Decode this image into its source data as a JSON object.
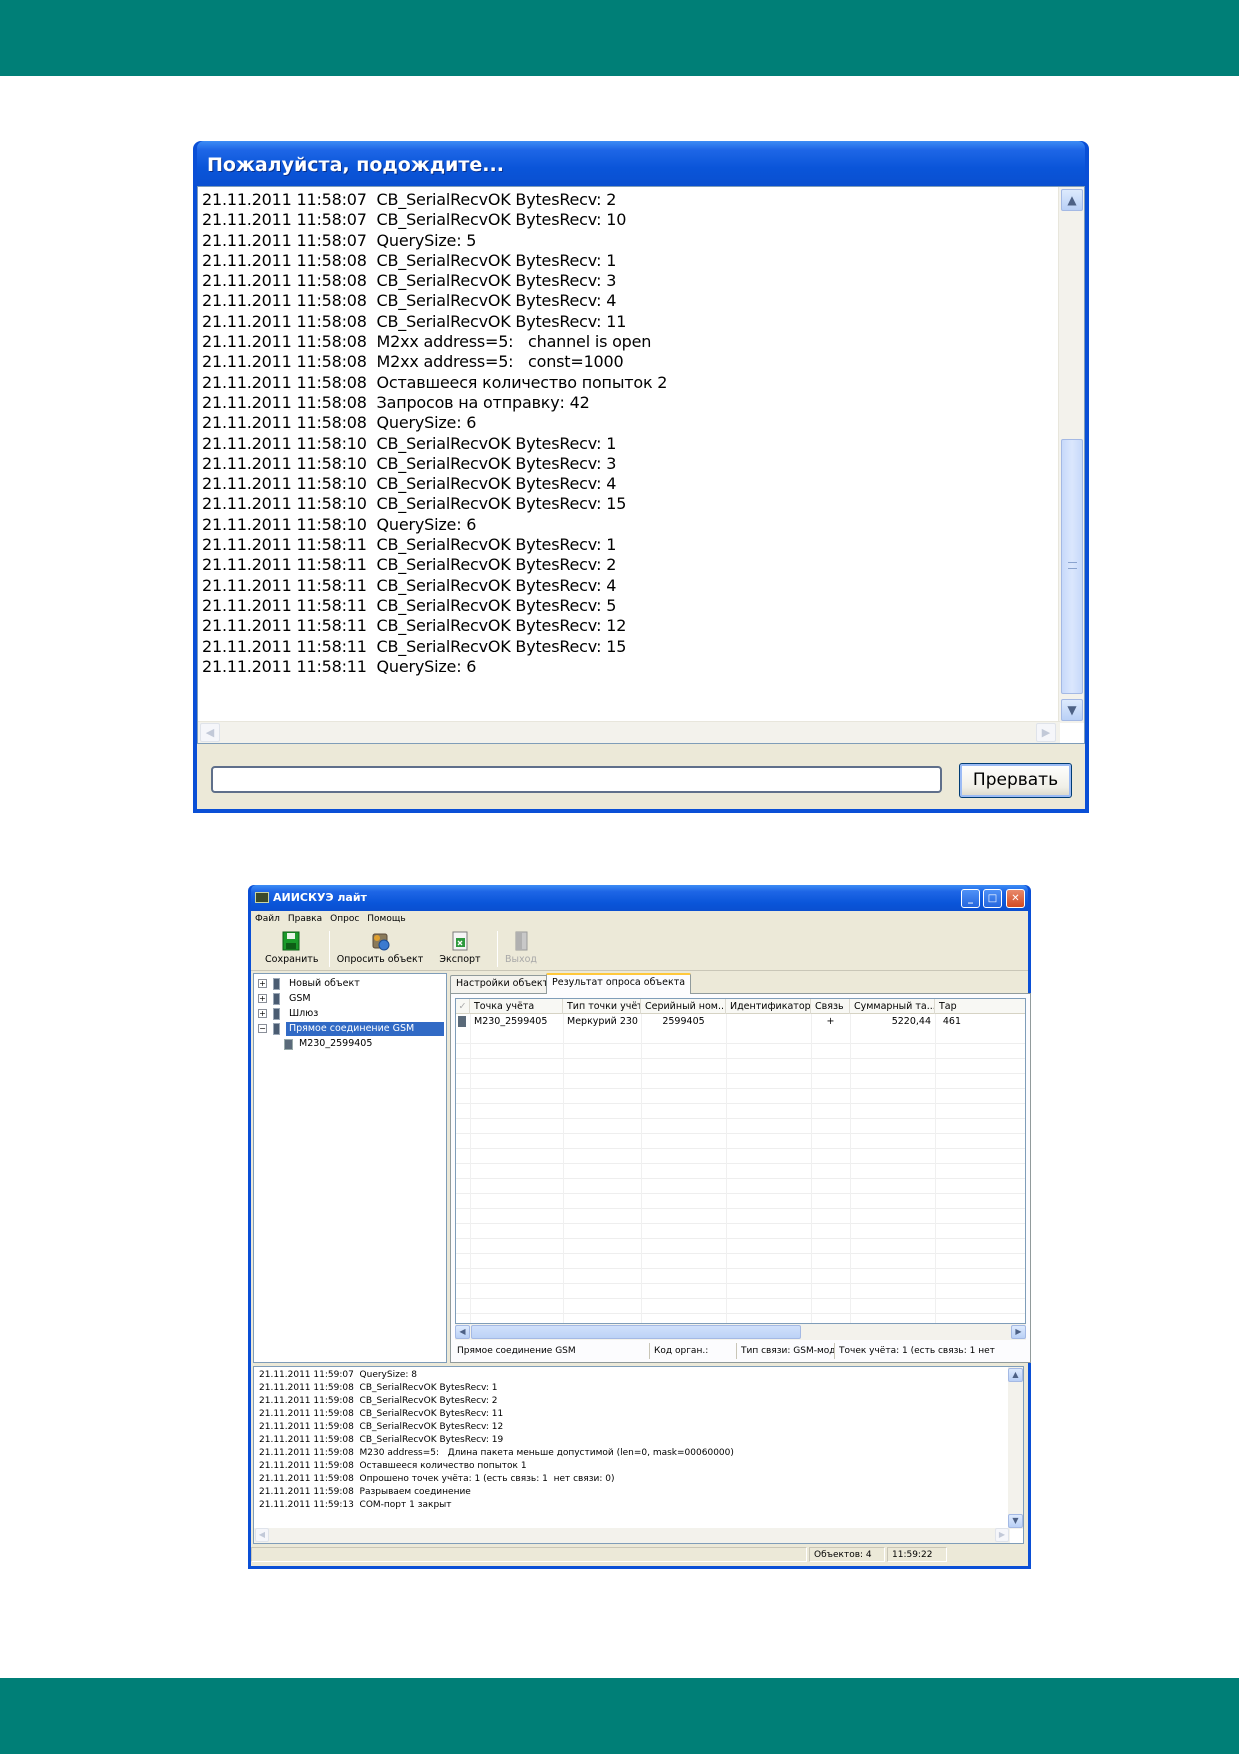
{
  "wait_dialog": {
    "title": "Пожалуйста, подождите...",
    "log": [
      "21.11.2011 11:58:07  CB_SerialRecvOK BytesRecv: 2",
      "21.11.2011 11:58:07  CB_SerialRecvOK BytesRecv: 10",
      "21.11.2011 11:58:07  QuerySize: 5",
      "21.11.2011 11:58:08  CB_SerialRecvOK BytesRecv: 1",
      "21.11.2011 11:58:08  CB_SerialRecvOK BytesRecv: 3",
      "21.11.2011 11:58:08  CB_SerialRecvOK BytesRecv: 4",
      "21.11.2011 11:58:08  CB_SerialRecvOK BytesRecv: 11",
      "21.11.2011 11:58:08  M2xx address=5:   channel is open",
      "21.11.2011 11:58:08  M2xx address=5:   const=1000",
      "21.11.2011 11:58:08  Оставшееся количество попыток 2",
      "21.11.2011 11:58:08  Запросов на отправку: 42",
      "21.11.2011 11:58:08  QuerySize: 6",
      "21.11.2011 11:58:10  CB_SerialRecvOK BytesRecv: 1",
      "21.11.2011 11:58:10  CB_SerialRecvOK BytesRecv: 3",
      "21.11.2011 11:58:10  CB_SerialRecvOK BytesRecv: 4",
      "21.11.2011 11:58:10  CB_SerialRecvOK BytesRecv: 15",
      "21.11.2011 11:58:10  QuerySize: 6",
      "21.11.2011 11:58:11  CB_SerialRecvOK BytesRecv: 1",
      "21.11.2011 11:58:11  CB_SerialRecvOK BytesRecv: 2",
      "21.11.2011 11:58:11  CB_SerialRecvOK BytesRecv: 4",
      "21.11.2011 11:58:11  CB_SerialRecvOK BytesRecv: 5",
      "21.11.2011 11:58:11  CB_SerialRecvOK BytesRecv: 12",
      "21.11.2011 11:58:11  CB_SerialRecvOK BytesRecv: 15",
      "21.11.2011 11:58:11  QuerySize: 6"
    ],
    "abort_label": "Прервать"
  },
  "app": {
    "title": "АИИСКУЭ лайт",
    "menu": [
      "Файл",
      "Правка",
      "Опрос",
      "Помощь"
    ],
    "toolbar": {
      "save": "Сохранить",
      "poll": "Опросить объект",
      "export": "Экспорт",
      "exit": "Выход"
    },
    "tree": {
      "items": [
        "Новый объект",
        "GSM",
        "Шлюз",
        "Прямое соединение GSM"
      ],
      "child": "M230_2599405"
    },
    "tabs": [
      "Настройки объекта",
      "Результат опроса объекта"
    ],
    "grid": {
      "headers": [
        "Точка учёта",
        "Тип точки учёта",
        "Серийный ном...",
        "Идентификатор",
        "Связь",
        "Суммарный та...",
        "Тар"
      ],
      "row": [
        "M230_2599405",
        "Меркурий 230",
        "2599405",
        "",
        "+",
        "5220,44",
        "461"
      ]
    },
    "panel_status": {
      "connection": "Прямое соединение GSM",
      "org_code": "Код орган.:",
      "link_type": "Тип связи: GSM-модем",
      "points": "Точек учёта: 1 (есть связь: 1  нет"
    },
    "log": [
      "21.11.2011 11:59:07  QuerySize: 8",
      "21.11.2011 11:59:08  CB_SerialRecvOK BytesRecv: 1",
      "21.11.2011 11:59:08  CB_SerialRecvOK BytesRecv: 2",
      "21.11.2011 11:59:08  CB_SerialRecvOK BytesRecv: 11",
      "21.11.2011 11:59:08  CB_SerialRecvOK BytesRecv: 12",
      "21.11.2011 11:59:08  CB_SerialRecvOK BytesRecv: 19",
      "21.11.2011 11:59:08  M230 address=5:   Длина пакета меньше допустимой (len=0, mask=00060000)",
      "21.11.2011 11:59:08  Оставшееся количество попыток 1",
      "21.11.2011 11:59:08  Опрошено точек учёта: 1 (есть связь: 1  нет связи: 0)",
      "21.11.2011 11:59:08  Разрываем соединение",
      "21.11.2011 11:59:13  COM-порт 1 закрыт"
    ],
    "status": {
      "objects": "Объектов: 4",
      "time": "11:59:22"
    }
  },
  "colors": {
    "band": "#007f77",
    "xp_title": "#0a55d9",
    "selection": "#316ac5"
  }
}
